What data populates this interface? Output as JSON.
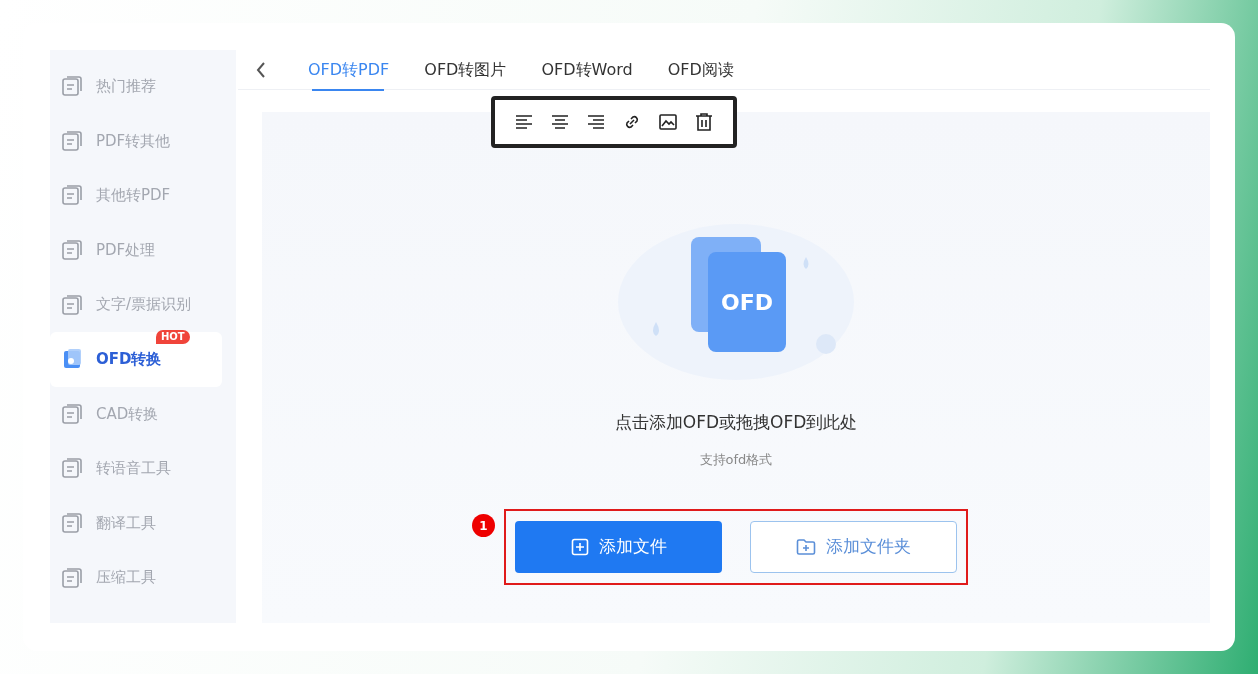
{
  "sidebar": {
    "items": [
      {
        "label": "热门推荐",
        "selected": false
      },
      {
        "label": "PDF转其他",
        "selected": false
      },
      {
        "label": "其他转PDF",
        "selected": false
      },
      {
        "label": "PDF处理",
        "selected": false
      },
      {
        "label": "文字/票据识别",
        "selected": false
      },
      {
        "label": "OFD转换",
        "selected": true,
        "badge": "HOT"
      },
      {
        "label": "CAD转换",
        "selected": false
      },
      {
        "label": "转语音工具",
        "selected": false
      },
      {
        "label": "翻译工具",
        "selected": false
      },
      {
        "label": "压缩工具",
        "selected": false
      }
    ]
  },
  "tabs": [
    {
      "label": "OFD转PDF",
      "selected": true
    },
    {
      "label": "OFD转图片",
      "selected": false
    },
    {
      "label": "OFD转Word",
      "selected": false
    },
    {
      "label": "OFD阅读",
      "selected": false
    }
  ],
  "toolbar": {
    "buttons": [
      {
        "kind": "align-left"
      },
      {
        "kind": "align-center"
      },
      {
        "kind": "align-right"
      },
      {
        "kind": "link"
      },
      {
        "kind": "image"
      },
      {
        "kind": "delete"
      }
    ]
  },
  "upload": {
    "illustration_label": "OFD",
    "title": "点击添加OFD或拖拽OFD到此处",
    "hint": "支持ofd格式",
    "step_marker": "1",
    "buttons": [
      {
        "label": "添加文件",
        "kind": "primary"
      },
      {
        "label": "添加文件夹",
        "kind": "outline"
      }
    ]
  }
}
